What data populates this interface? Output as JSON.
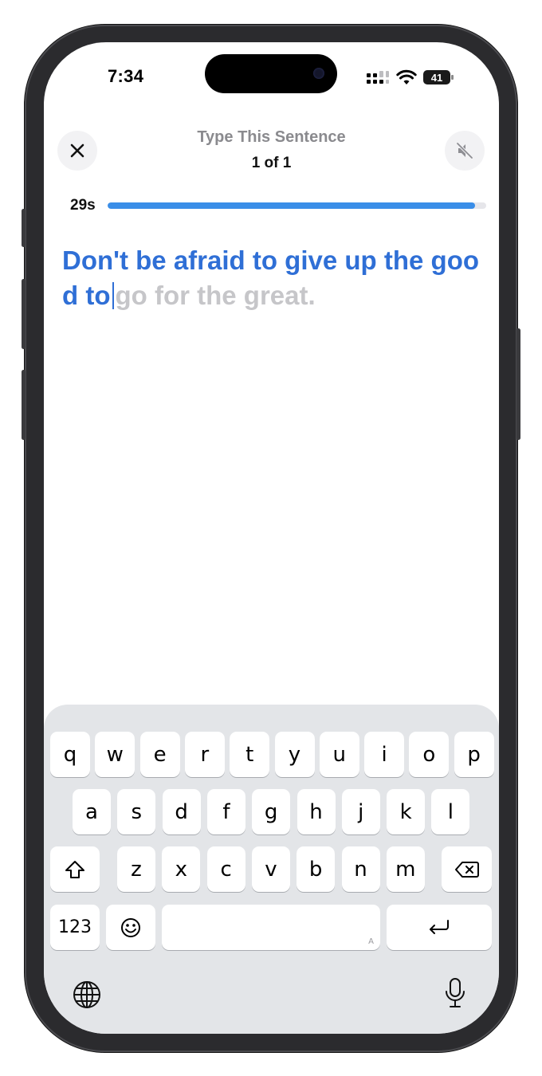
{
  "status_bar": {
    "time": "7:34",
    "battery": "41"
  },
  "header": {
    "title": "Type This Sentence",
    "progress_text": "1 of 1"
  },
  "timer": {
    "label": "29s",
    "remaining_fraction": 0.97
  },
  "sentence": {
    "typed": "Don't be afraid to give up the good to",
    "remaining": "go for the great."
  },
  "keyboard": {
    "rows": [
      [
        "q",
        "w",
        "e",
        "r",
        "t",
        "y",
        "u",
        "i",
        "o",
        "p"
      ],
      [
        "a",
        "s",
        "d",
        "f",
        "g",
        "h",
        "j",
        "k",
        "l"
      ],
      [
        "z",
        "x",
        "c",
        "v",
        "b",
        "n",
        "m"
      ]
    ],
    "numbers_label": "123",
    "space_label": "",
    "space_corner": "A"
  },
  "icons": [
    "close-icon",
    "speaker-muted-icon",
    "shift-icon",
    "delete-icon",
    "emoji-icon",
    "return-icon",
    "globe-icon",
    "microphone-icon",
    "cellular-icon",
    "wifi-icon"
  ],
  "colors": {
    "accent": "#2f6fd6",
    "progress": "#3a8ee8",
    "remaining_text": "#c6c6c9",
    "keyboard_bg": "#e3e5e8"
  }
}
